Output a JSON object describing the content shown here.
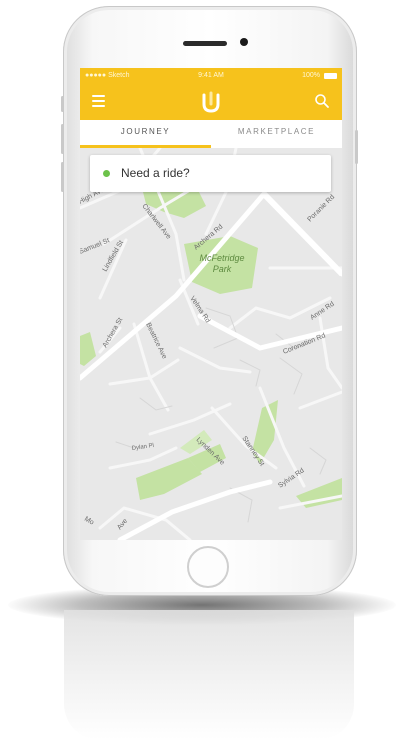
{
  "status_bar": {
    "carrier": "●●●●● Sketch",
    "time": "9:41 AM",
    "battery": "100%"
  },
  "app_bar": {
    "logo": "U"
  },
  "tabs": [
    {
      "label": "JOURNEY",
      "active": true
    },
    {
      "label": "MARKETPLACE",
      "active": false
    }
  ],
  "ride_prompt": {
    "label": "Need a ride?"
  },
  "map": {
    "park_name_line1": "McFetridge",
    "park_name_line2": "Park",
    "streets": [
      "High Ave",
      "Charlwell Ave",
      "Archera Rd",
      "Poranie Rd",
      "Samuel St",
      "Lindfield St",
      "Velma Rd",
      "Archera St",
      "Beatrice Ave",
      "Anne Rd",
      "Coronation Rd",
      "Lynden Ave",
      "Dylan Pl",
      "Stanney St",
      "Sylvia Rd",
      "Mo",
      "Ave"
    ]
  },
  "colors": {
    "accent": "#f6c21c",
    "status_dot": "#6cc24a",
    "map_background": "#e8e8e8",
    "park": "#c4e2a3"
  }
}
